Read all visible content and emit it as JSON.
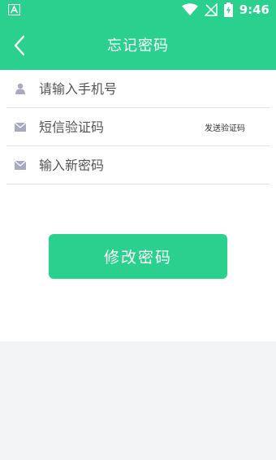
{
  "status_bar": {
    "time": "9:46",
    "app_icon": "a-app-icon",
    "wifi_icon": "wifi-icon",
    "signal_icon": "no-signal-icon",
    "battery_icon": "battery-charging-icon"
  },
  "header": {
    "title": "忘记密码",
    "back_icon": "chevron-left-icon"
  },
  "form": {
    "phone": {
      "placeholder": "请输入手机号",
      "icon": "person-icon"
    },
    "sms_code": {
      "placeholder": "短信验证码",
      "icon": "envelope-icon",
      "send_label": "发送验证码"
    },
    "new_password": {
      "placeholder": "输入新密码",
      "icon": "envelope-icon"
    }
  },
  "submit": {
    "label": "修改密码"
  },
  "colors": {
    "accent": "#2ad08d",
    "divider": "#e2e2e2",
    "footer_bg": "#f3f4f6"
  }
}
